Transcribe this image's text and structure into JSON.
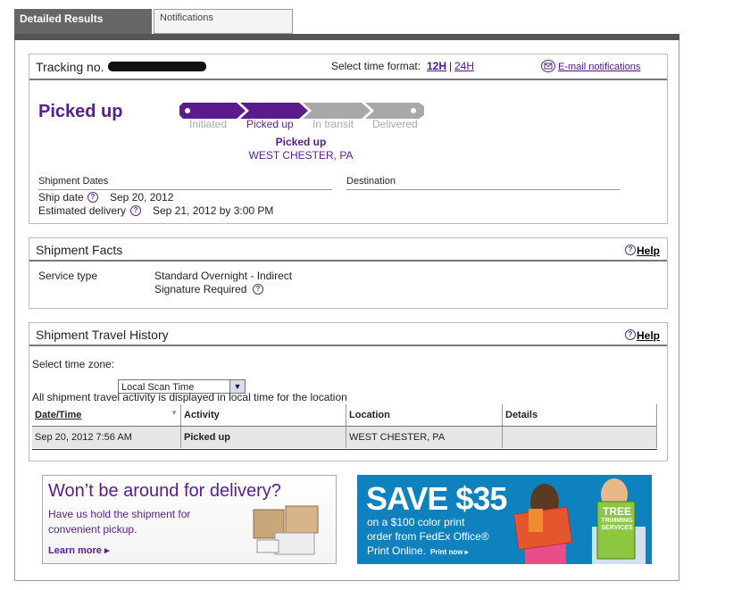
{
  "tabs": {
    "detailed": "Detailed Results",
    "notifications": "Notifications"
  },
  "tracking": {
    "label": "Tracking no.",
    "time_format_label": "Select time format:",
    "fmt12": "12H",
    "sep": "|",
    "fmt24": "24H",
    "email": "E-mail notifications"
  },
  "status": {
    "title": "Picked up",
    "steps": [
      "Initiated",
      "Picked up",
      "In transit",
      "Delivered"
    ],
    "current_label": "Picked up",
    "current_location": "WEST CHESTER, PA"
  },
  "dates": {
    "heading": "Shipment Dates",
    "destination_heading": "Destination",
    "ship_label": "Ship date",
    "ship_value": "Sep 20, 2012",
    "eta_label": "Estimated delivery",
    "eta_value": "Sep 21, 2012 by 3:00 PM"
  },
  "facts": {
    "title": "Shipment Facts",
    "help": "Help",
    "service_label": "Service type",
    "service_value": "Standard Overnight - Indirect",
    "signature": "Signature Required"
  },
  "history": {
    "title": "Shipment Travel History",
    "help": "Help",
    "tz_label": "Select time zone:",
    "tz_value": "Local Scan Time",
    "note": "All shipment travel activity is displayed in local time for the location",
    "columns": [
      "Date/Time",
      "Activity",
      "Location",
      "Details"
    ],
    "rows": [
      {
        "datetime": "Sep 20, 2012 7:56 AM",
        "activity": "Picked up",
        "location": "WEST CHESTER, PA",
        "details": ""
      }
    ]
  },
  "ads": {
    "ad1_headline": "Won’t be around for delivery?",
    "ad1_line1": "Have us hold the shipment for",
    "ad1_line2": "convenient pickup.",
    "ad1_link": "Learn more ▸",
    "ad2_headline": "SAVE $35",
    "ad2_line1": "on a $100 color print",
    "ad2_line2": "order from FedEx Office®",
    "ad2_line3": "Print Online.",
    "ad2_cta": "Print now ▸",
    "ad2_badge1": "TREE",
    "ad2_badge2": "TRIMMING",
    "ad2_badge3": "SERVICES"
  },
  "colors": {
    "purple": "#5a1c8c",
    "progress_grey": "#a8a8a8",
    "ad_blue": "#0d82bf"
  }
}
